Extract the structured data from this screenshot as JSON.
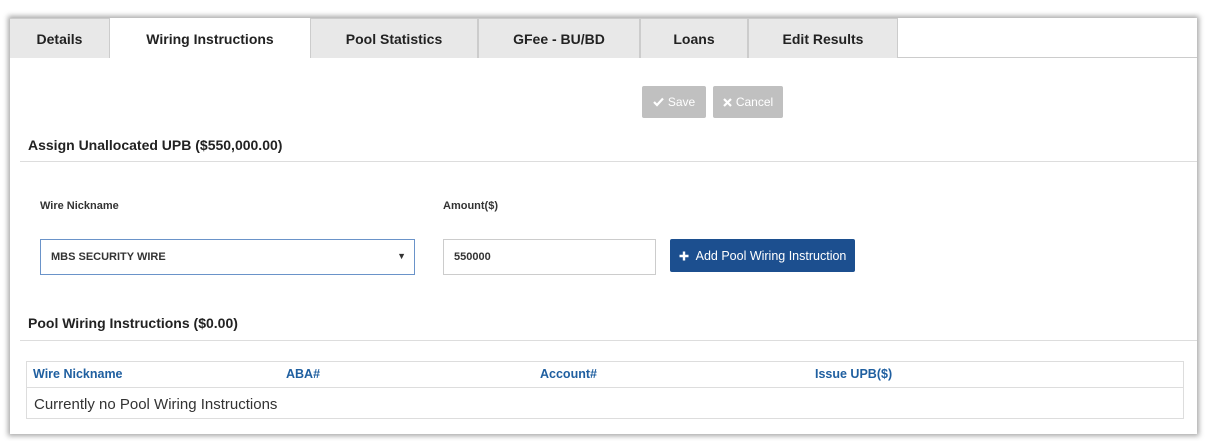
{
  "tabs": [
    {
      "label": "Details",
      "active": false
    },
    {
      "label": "Wiring Instructions",
      "active": true
    },
    {
      "label": "Pool Statistics",
      "active": false
    },
    {
      "label": "GFee - BU/BD",
      "active": false
    },
    {
      "label": "Loans",
      "active": false
    },
    {
      "label": "Edit Results",
      "active": false
    }
  ],
  "toolbar": {
    "save_label": "Save",
    "cancel_label": "Cancel"
  },
  "assign": {
    "title": "Assign Unallocated UPB ($550,000.00)",
    "wire_nickname_label": "Wire Nickname",
    "amount_label": "Amount($)",
    "wire_nickname_value": "MBS SECURITY WIRE",
    "amount_value": "550000",
    "add_button_label": "Add Pool Wiring Instruction"
  },
  "pool": {
    "title": "Pool Wiring Instructions ($0.00)",
    "columns": [
      "Wire Nickname",
      "ABA#",
      "Account#",
      "Issue UPB($)"
    ],
    "empty_message": "Currently no Pool Wiring Instructions"
  },
  "colors": {
    "primary": "#1c4f8f",
    "link": "#1f5fa0",
    "disabled": "#c0c0c0"
  }
}
